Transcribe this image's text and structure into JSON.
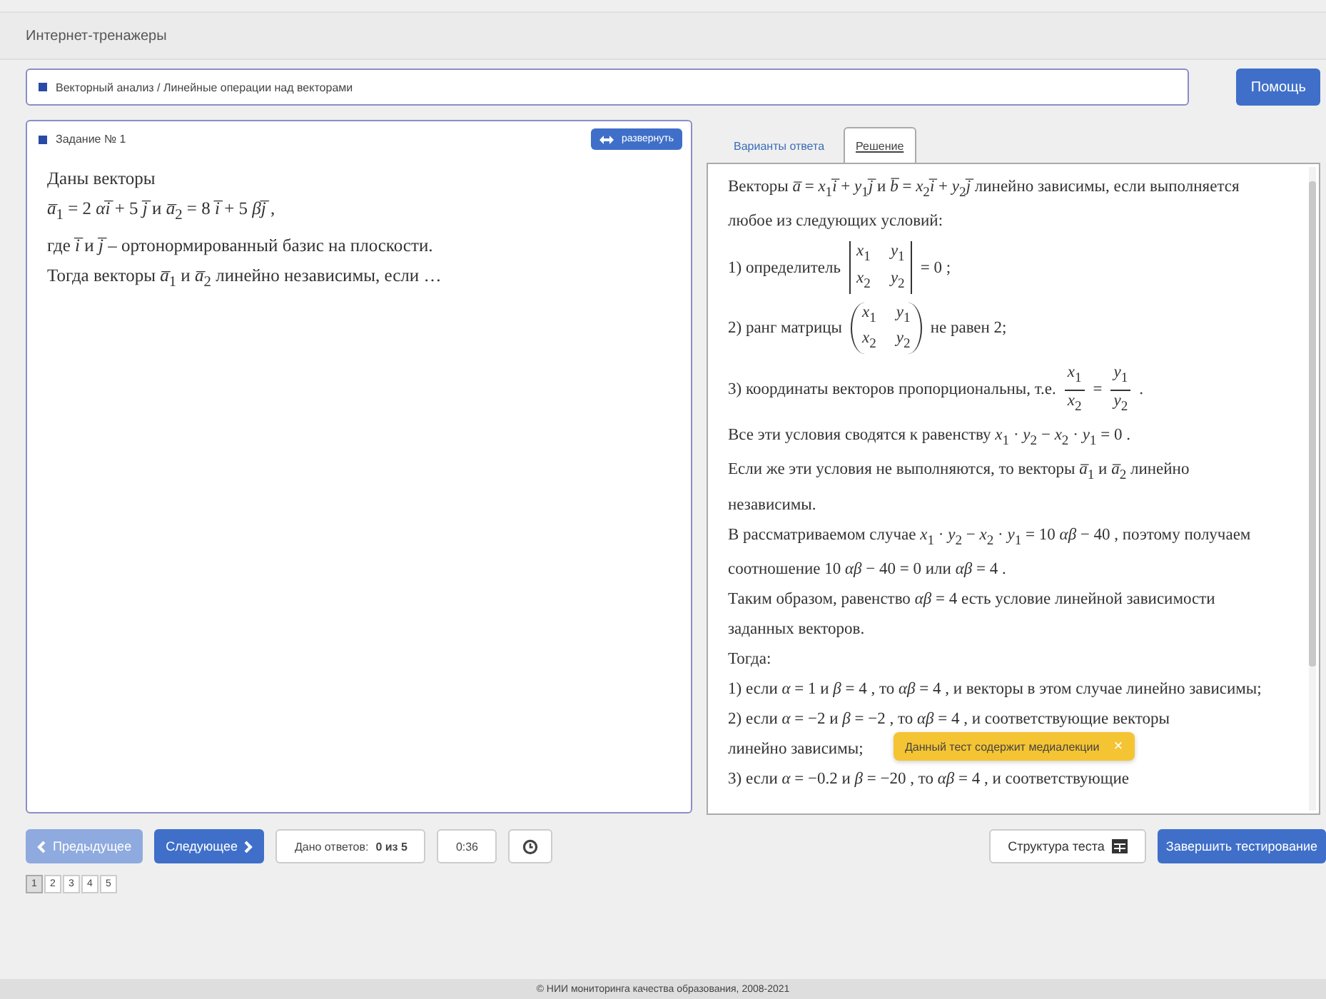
{
  "header": {
    "title": "Интернет-тренажеры"
  },
  "breadcrumb": {
    "text": "Векторный анализ / Линейные операции над векторами"
  },
  "help_button": "Помощь",
  "task": {
    "title": "Задание № 1",
    "expand_button": "развернуть",
    "lines": [
      "Даны векторы",
      "*a̅*$_{1}$ = 2 *αi̅* + 5 *j̅*  и  *a̅*$_{2}$ = 8 *i̅* + 5 *βj̅* ,",
      "где *i̅*  и  *j̅*  – ортонормированный базис на плоскости.",
      "Тогда векторы *a̅*$_{1}$  и  *a̅*$_{2}$  линейно независимы, если …"
    ]
  },
  "tabs": [
    {
      "label": "Варианты ответа",
      "selected": false
    },
    {
      "label": "Решение",
      "selected": true
    }
  ],
  "solution": [
    {
      "kind": "text",
      "text": "Векторы *a̅* = *x*$_{1}$*i̅* + *y*$_{1}$*j̅*  и  *b̅* = *x*$_{2}$*i̅* + *y*$_{2}$*j̅*  линейно зависимы, если выполняется любое из следующих условий:"
    },
    {
      "kind": "det",
      "prefix": "1) определитель",
      "cells": [
        "*x*$_{1}$",
        "*y*$_{1}$",
        "*x*$_{2}$",
        "*y*$_{2}$"
      ],
      "suffix": "= 0 ;"
    },
    {
      "kind": "matrix",
      "prefix": "2) ранг матрицы",
      "cells": [
        "*x*$_{1}$",
        "*y*$_{1}$",
        "*x*$_{2}$",
        "*y*$_{2}$"
      ],
      "suffix": "не равен 2;"
    },
    {
      "kind": "frac",
      "prefix": "3) координаты векторов пропорциональны, т.е.",
      "fractions": [
        {
          "num": "*x*$_{1}$",
          "den": "*x*$_{2}$"
        },
        {
          "num": "*y*$_{1}$",
          "den": "*y*$_{2}$"
        }
      ],
      "joiner": "=",
      "suffix": "."
    },
    {
      "kind": "text",
      "text": "Все эти условия сводятся к равенству  *x*$_{1}$ · *y*$_{2}$ − *x*$_{2}$ · *y*$_{1}$ = 0 ."
    },
    {
      "kind": "text",
      "text": "Если же эти условия не выполняются, то векторы  *a̅*$_{1}$  и  *a̅*$_{2}$  линейно независимы."
    },
    {
      "kind": "text",
      "text": "В рассматриваемом случае  *x*$_{1}$ · *y*$_{2}$ − *x*$_{2}$ · *y*$_{1}$ = 10 *αβ* − 40 , поэтому получаем соотношение  10 *αβ* − 40 = 0  или  *αβ* = 4 ."
    },
    {
      "kind": "text",
      "text": "Таким образом, равенство  *αβ* = 4  есть условие линейной зависимости заданных векторов."
    },
    {
      "kind": "text",
      "text": "Тогда:"
    },
    {
      "kind": "text",
      "text": "1) если  *α* = 1  и  *β* = 4 , то  *αβ* = 4 , и векторы в этом случае линейно зависимы;"
    },
    {
      "kind": "text",
      "text": "2) если  *α* = −2  и  *β* = −2 , то  *αβ* = 4 , и соответствующие векторы"
    },
    {
      "kind": "text",
      "text": "линейно зависимы;"
    },
    {
      "kind": "text",
      "text": "3) если  *α* = −0.2  и  *β* = −20 , то  *αβ* = 4 , и соответствующие"
    }
  ],
  "tooltip": {
    "text": "Данный тест содержит медиалекции",
    "close": "×"
  },
  "nav": {
    "prev": {
      "label": "Предыдущее",
      "disabled": true
    },
    "next": {
      "label": "Следующее",
      "disabled": false
    },
    "answered": "Дано ответов: **0 из 5**",
    "timer": "0:36"
  },
  "structure_button": "Структура теста",
  "finish_button": "Завершить тестирование",
  "pages": [
    {
      "label": "1",
      "selected": true
    },
    {
      "label": "2",
      "selected": false
    },
    {
      "label": "3",
      "selected": false
    },
    {
      "label": "4",
      "selected": false
    },
    {
      "label": "5",
      "selected": false
    }
  ],
  "footer": "© НИИ мониторинга качества образования, 2008-2021"
}
